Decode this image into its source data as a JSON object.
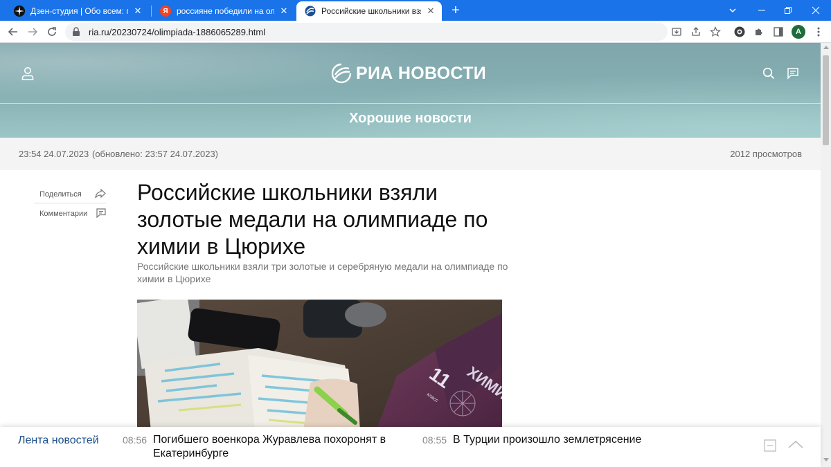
{
  "browser": {
    "tabs": [
      {
        "title": "Дзен-студия | Обо всем: про хо",
        "icon": "dzen-icon"
      },
      {
        "title": "россияне победили на олимпиа",
        "icon": "yandex-icon",
        "icon_text": "Я"
      },
      {
        "title": "Российские школьники взяли зо",
        "icon": "ria-icon"
      }
    ],
    "url": "ria.ru/20230724/olimpiada-1886065289.html",
    "profile_initial": "A",
    "accent": "#1a73e8"
  },
  "site": {
    "logo_text": "РИА НОВОСТИ",
    "section": "Хорошие новости"
  },
  "article": {
    "published": "23:54 24.07.2023",
    "updated": "(обновлено: 23:57 24.07.2023)",
    "views": "2012 просмотров",
    "share_label": "Поделиться",
    "comments_label": "Комментарии",
    "title": "Российские школьники взяли золотые медали на олимпиаде по химии в Цюрихе",
    "subtitle": "Российские школьники взяли три золотые и серебряную медали на олимпиаде по химии в Цюрихе",
    "photo_text": {
      "book_title": "ХИМИЯ",
      "book_grade": "11",
      "book_grade_word": "класс"
    }
  },
  "ticker": {
    "label": "Лента новостей",
    "items": [
      {
        "time": "08:56",
        "text_line1": "Погибшего военкора Журавлева похоронят в",
        "text_line2": "Екатеринбурге"
      },
      {
        "time": "08:55",
        "text_line1": "В Турции произошло землетрясение",
        "text_line2": ""
      }
    ]
  }
}
